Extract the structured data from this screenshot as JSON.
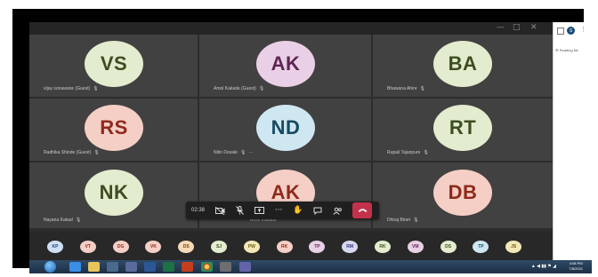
{
  "window": {
    "minimize": "—",
    "maximize": "□",
    "close": "✕"
  },
  "participants": [
    {
      "initials": "VS",
      "name": "vijay sonawane (Guest)",
      "bg": "#e3ecce",
      "fg": "#3d4d22"
    },
    {
      "initials": "AK",
      "name": "Amol Kakade (Guest)",
      "bg": "#e9d0e6",
      "fg": "#5e2554"
    },
    {
      "initials": "BA",
      "name": "Bhawana Ahire",
      "bg": "#e3ecce",
      "fg": "#3d4d22"
    },
    {
      "initials": "RS",
      "name": "Radhika Shinde (Guest)",
      "bg": "#f5cfc5",
      "fg": "#8e2a1c"
    },
    {
      "initials": "ND",
      "name": "Nitin Desale",
      "bg": "#cfe7f1",
      "fg": "#174a62"
    },
    {
      "initials": "RT",
      "name": "Rupali Tajanpure",
      "bg": "#e3ecce",
      "fg": "#3d4d22"
    },
    {
      "initials": "NK",
      "name": "Nayana Kakad",
      "bg": "#e3ecce",
      "fg": "#3d4d22"
    },
    {
      "initials": "AK",
      "name": "Amol Kakade",
      "bg": "#f5cfc5",
      "fg": "#8e2a1c"
    },
    {
      "initials": "DB",
      "name": "Dhiraj Birari",
      "bg": "#f5cfc5",
      "fg": "#8e2a1c"
    }
  ],
  "toolbar": {
    "timer": "02:38",
    "icons": [
      "camera-off-icon",
      "mic-off-icon",
      "share-screen-icon",
      "more-icon",
      "raise-hand-icon",
      "chat-icon",
      "people-icon",
      "hang-up-icon"
    ]
  },
  "strip": [
    {
      "initials": "KP",
      "bg": "#cfe0f5",
      "fg": "#1f3f73"
    },
    {
      "initials": "VT",
      "bg": "#f5cfc5",
      "fg": "#8e2a1c"
    },
    {
      "initials": "DG",
      "bg": "#f5cfc5",
      "fg": "#8e2a1c"
    },
    {
      "initials": "VK",
      "bg": "#f5cfc5",
      "fg": "#8e2a1c"
    },
    {
      "initials": "DS",
      "bg": "#f7d9b8",
      "fg": "#7a4310"
    },
    {
      "initials": "SJ",
      "bg": "#e3ecce",
      "fg": "#3d4d22"
    },
    {
      "initials": "PW",
      "bg": "#f1e8b5",
      "fg": "#6b5a10"
    },
    {
      "initials": "RK",
      "bg": "#f5cfc5",
      "fg": "#8e2a1c"
    },
    {
      "initials": "TP",
      "bg": "#e9d0e6",
      "fg": "#5e2554"
    },
    {
      "initials": "RM",
      "bg": "#d7d9f2",
      "fg": "#2e3475"
    },
    {
      "initials": "RK",
      "bg": "#e3ecce",
      "fg": "#3d4d22"
    },
    {
      "initials": "VM",
      "bg": "#e9d0e6",
      "fg": "#5e2554"
    },
    {
      "initials": "DS",
      "bg": "#e3ecce",
      "fg": "#3d4d22"
    },
    {
      "initials": "TP",
      "bg": "#cfe7f1",
      "fg": "#174a62"
    },
    {
      "initials": "JS",
      "bg": "#f1e8b5",
      "fg": "#6b5a10"
    }
  ],
  "browser": {
    "reading_list": "Reading list",
    "profile_initial": "S"
  },
  "taskbar": {
    "time": "4:08 PM",
    "date": "7/8/2021"
  },
  "colors": {
    "accent": "#6264a7",
    "hangup": "#c4314b"
  }
}
